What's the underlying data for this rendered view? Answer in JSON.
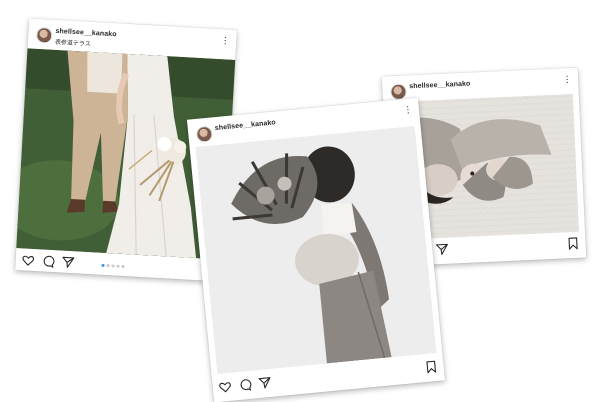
{
  "posts": [
    {
      "username": "shellsee__kanako",
      "location": "表参道テラス",
      "photo_description": "wedding couple holding dried flower bouquet on grass",
      "carousel_dots": 5,
      "carousel_active": 1
    },
    {
      "username": "shellsee__kanako",
      "photo_description": "maternity portrait with flower bouquet, black and white"
    },
    {
      "username": "shellsee__kanako",
      "photo_description": "woman lying with newborn twins, black and white"
    }
  ],
  "icons": [
    "like-heart-icon",
    "comment-icon",
    "share-icon",
    "bookmark-icon",
    "more-options-icon"
  ]
}
